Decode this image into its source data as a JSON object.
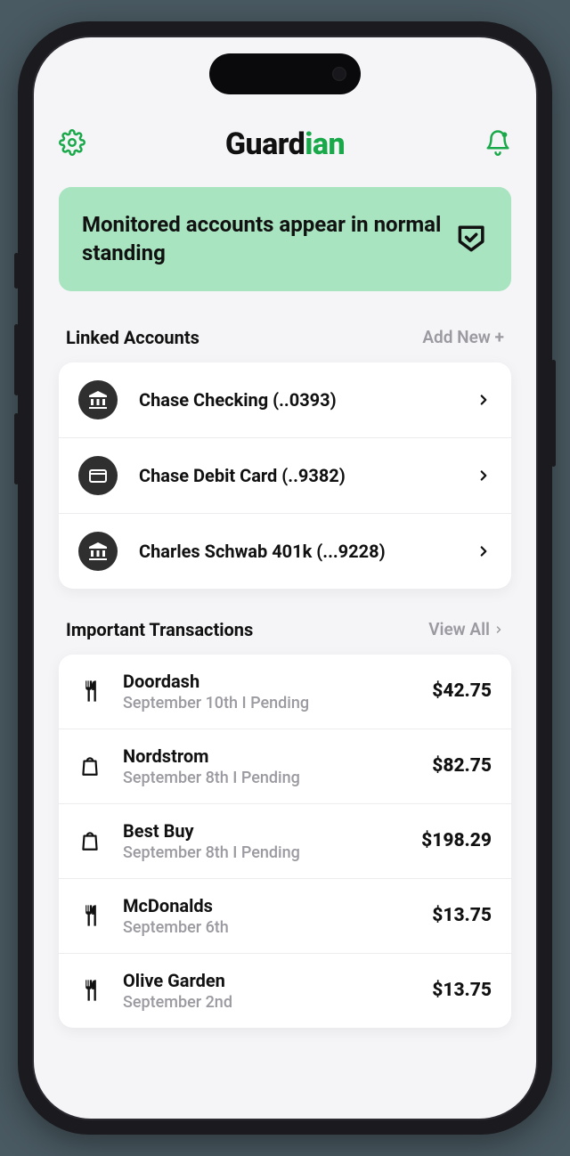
{
  "brand": {
    "part1": "Guard",
    "part2": "ian"
  },
  "status": {
    "message": "Monitored accounts appear in normal standing"
  },
  "linked": {
    "title": "Linked Accounts",
    "action": "Add New +",
    "items": [
      {
        "label": "Chase Checking (..0393)",
        "icon": "bank"
      },
      {
        "label": "Chase Debit Card (..9382)",
        "icon": "card"
      },
      {
        "label": "Charles Schwab 401k (...9228)",
        "icon": "bank"
      }
    ]
  },
  "transactions": {
    "title": "Important Transactions",
    "action": "View All",
    "items": [
      {
        "name": "Doordash",
        "sub": "September 10th   I   Pending",
        "amount": "$42.75",
        "icon": "food"
      },
      {
        "name": "Nordstrom",
        "sub": "September 8th   I   Pending",
        "amount": "$82.75",
        "icon": "bag"
      },
      {
        "name": "Best Buy",
        "sub": "September 8th   I   Pending",
        "amount": "$198.29",
        "icon": "bag"
      },
      {
        "name": "McDonalds",
        "sub": "September 6th",
        "amount": "$13.75",
        "icon": "food"
      },
      {
        "name": "Olive Garden",
        "sub": "September 2nd",
        "amount": "$13.75",
        "icon": "food"
      }
    ]
  }
}
